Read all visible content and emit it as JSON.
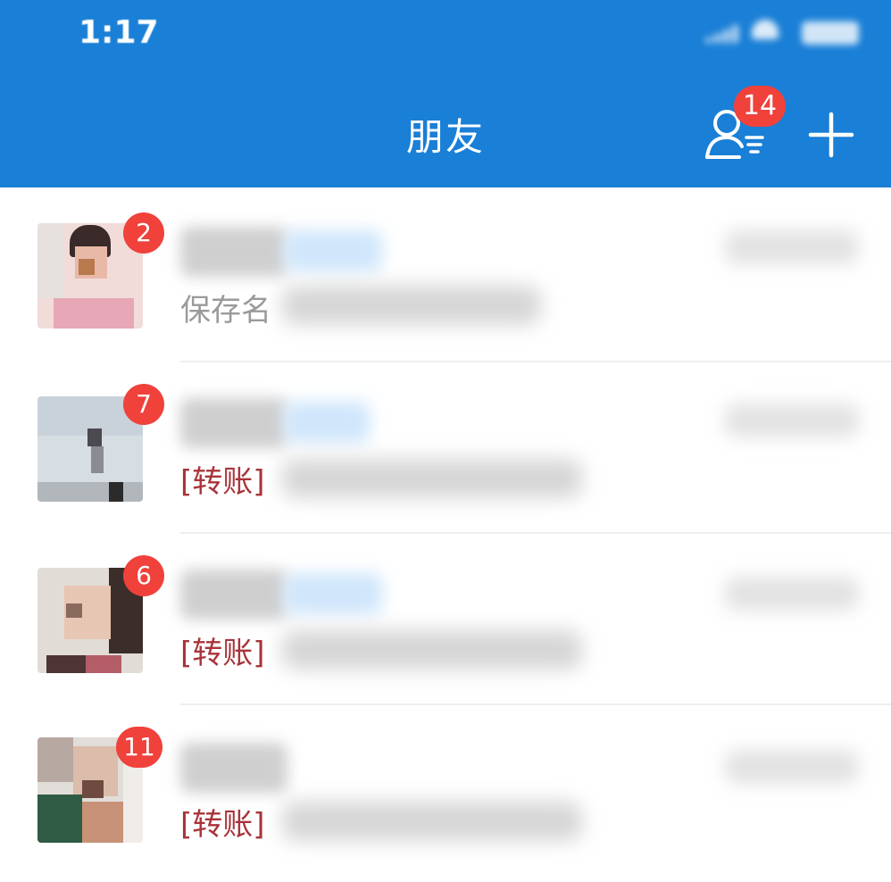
{
  "status_bar": {
    "time": "1:17"
  },
  "header": {
    "title": "朋友",
    "friend_requests_badge": "14",
    "friends_icon": "user-list-icon",
    "add_icon": "plus-icon"
  },
  "chats": [
    {
      "unread": "2",
      "preview_prefix": "保存名"
    },
    {
      "unread": "7",
      "preview_prefix": "[转账]"
    },
    {
      "unread": "6",
      "preview_prefix": "[转账]"
    },
    {
      "unread": "11",
      "preview_prefix": "[转账]"
    }
  ],
  "colors": {
    "header_bg": "#1a7fd6",
    "badge": "#f0413b",
    "transfer_text": "#a8343a",
    "preview_gray": "#9a9a9a"
  }
}
